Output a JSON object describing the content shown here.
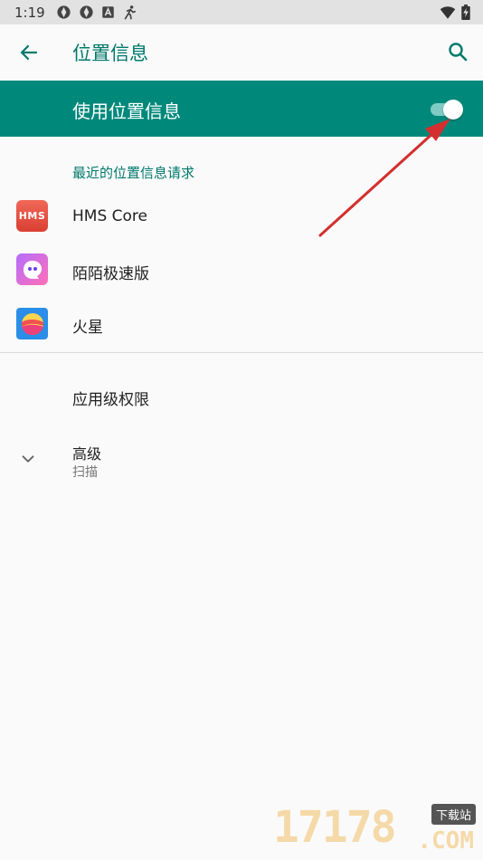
{
  "status_bar": {
    "time": "1:19",
    "left_icons": [
      "aperture-icon",
      "aperture-icon",
      "a-icon",
      "runner-icon"
    ],
    "right_icons": [
      "wifi-icon",
      "battery-charging-icon"
    ]
  },
  "app_bar": {
    "title": "位置信息",
    "back_icon": "arrow-left-icon",
    "search_icon": "search-icon"
  },
  "master_switch": {
    "label": "使用位置信息",
    "on": true,
    "colors": {
      "bar": "#00897b",
      "track": "#80cbc4",
      "thumb": "#ffffff"
    }
  },
  "recent_requests": {
    "header": "最近的位置信息请求",
    "apps": [
      {
        "name": "HMS Core",
        "icon_text": "HMS"
      },
      {
        "name": "陌陌极速版"
      },
      {
        "name": "火星"
      }
    ]
  },
  "permissions": {
    "label": "应用级权限"
  },
  "advanced": {
    "title": "高级",
    "subtitle": "扫描"
  },
  "watermark": {
    "digits": "17178",
    "badge": "下载站",
    "domain": ".COM"
  },
  "accent_color": "#00796b"
}
